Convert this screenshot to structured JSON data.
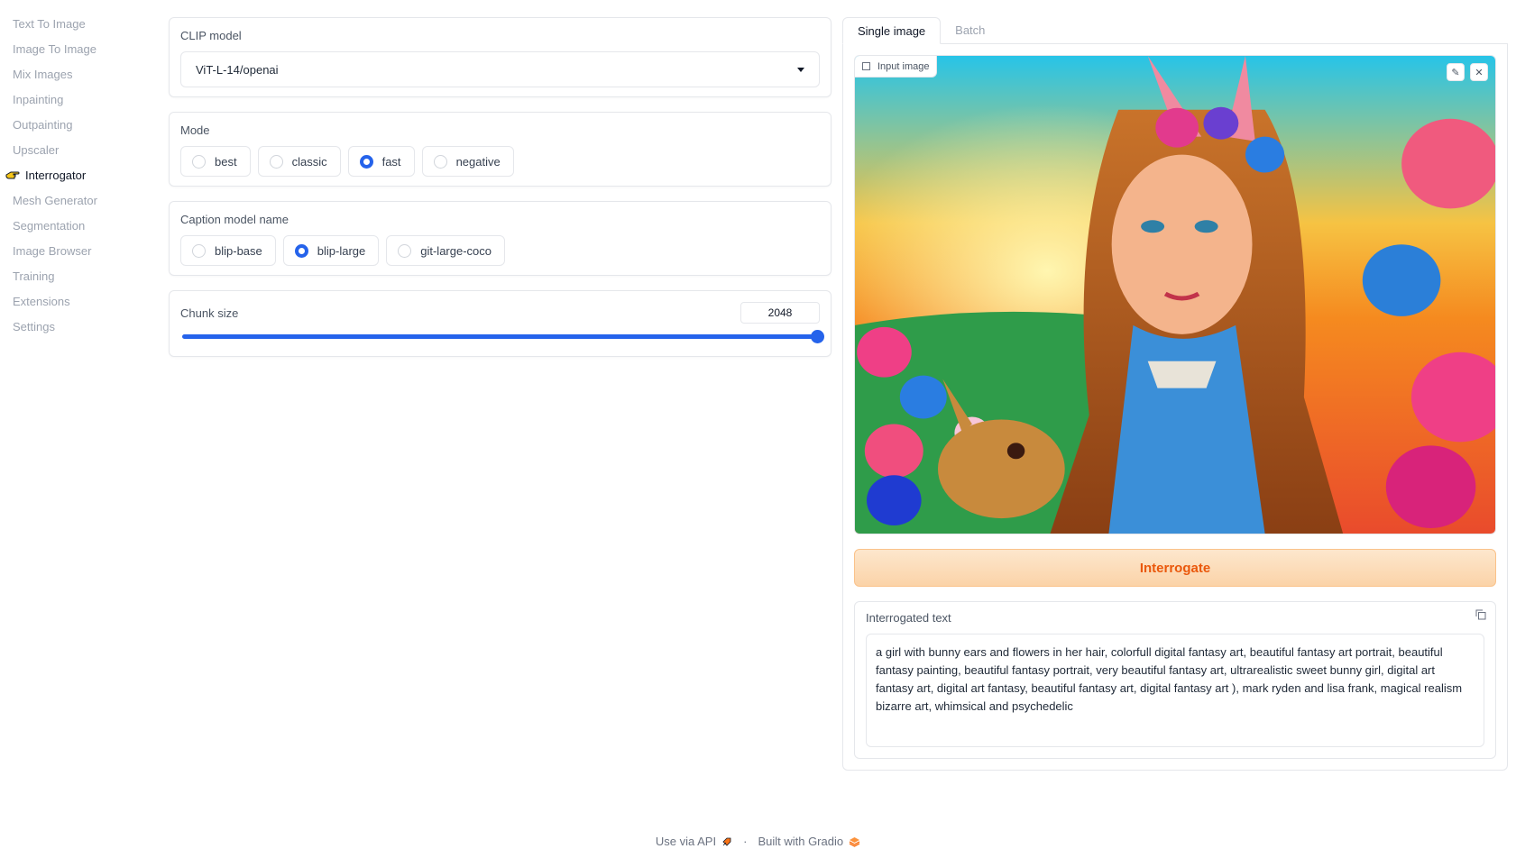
{
  "sidebar": {
    "items": [
      {
        "label": "Text To Image"
      },
      {
        "label": "Image To Image"
      },
      {
        "label": "Mix Images"
      },
      {
        "label": "Inpainting"
      },
      {
        "label": "Outpainting"
      },
      {
        "label": "Upscaler"
      },
      {
        "label": "Interrogator",
        "active": true
      },
      {
        "label": "Mesh Generator"
      },
      {
        "label": "Segmentation"
      },
      {
        "label": "Image Browser"
      },
      {
        "label": "Training"
      },
      {
        "label": "Extensions"
      },
      {
        "label": "Settings"
      }
    ]
  },
  "clip": {
    "label": "CLIP model",
    "value": "ViT-L-14/openai"
  },
  "mode": {
    "label": "Mode",
    "options": [
      "best",
      "classic",
      "fast",
      "negative"
    ],
    "selected": "fast"
  },
  "caption": {
    "label": "Caption model name",
    "options": [
      "blip-base",
      "blip-large",
      "git-large-coco"
    ],
    "selected": "blip-large"
  },
  "chunk": {
    "label": "Chunk size",
    "value": "2048",
    "fill_fraction": 1.0
  },
  "tabs": [
    {
      "label": "Single image",
      "active": true
    },
    {
      "label": "Batch",
      "active": false
    }
  ],
  "image": {
    "label": "Input image",
    "edit_icon": "pencil-icon",
    "close_icon": "close-icon"
  },
  "actions": {
    "interrogate": "Interrogate"
  },
  "output": {
    "label": "Interrogated text",
    "text": "a girl with bunny ears and flowers in her hair, colorfull digital fantasy art, beautiful fantasy art portrait, beautiful fantasy painting, beautiful fantasy portrait, very beautiful fantasy art, ultrarealistic sweet bunny girl, digital art fantasy art, digital art fantasy, beautiful fantasy art, digital fantasy art ), mark ryden and lisa frank, magical realism bizarre art, whimsical and psychedelic"
  },
  "footer": {
    "api": "Use via API",
    "separator": "·",
    "built": "Built with Gradio"
  },
  "colors": {
    "accent": "#2563eb",
    "primary_button_text": "#ea580c"
  }
}
